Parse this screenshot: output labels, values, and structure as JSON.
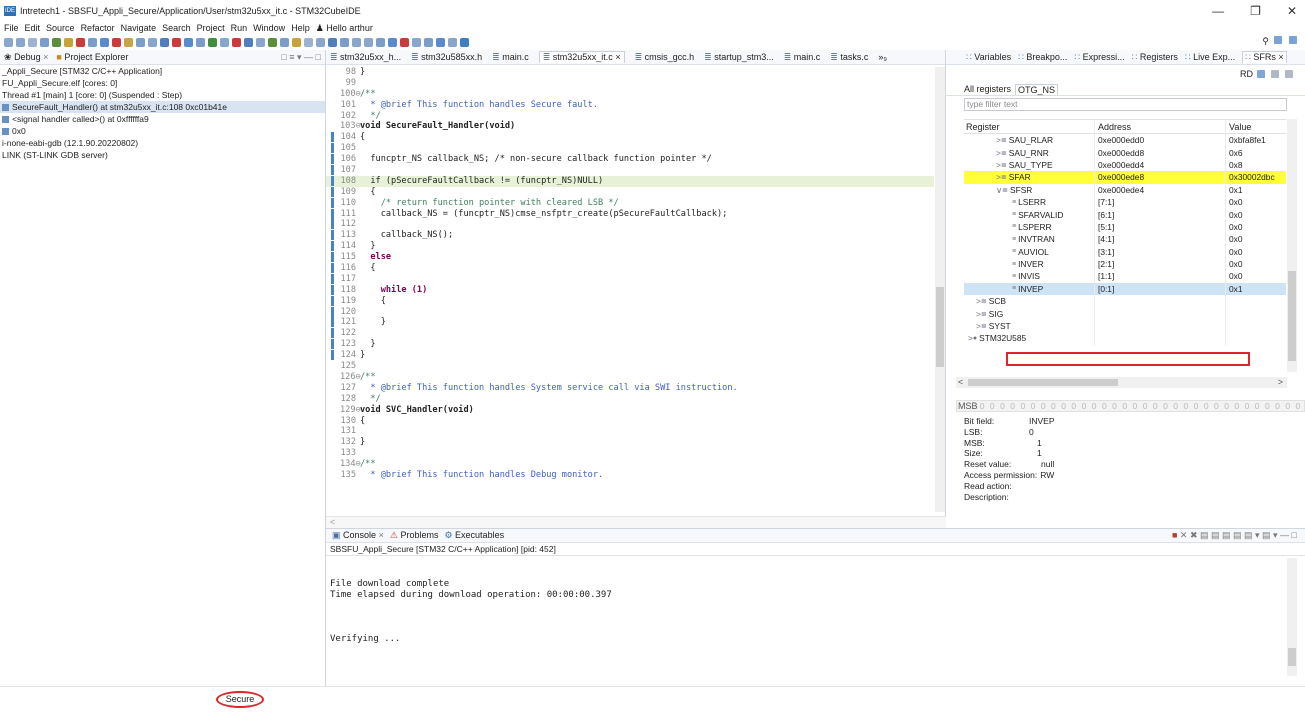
{
  "window": {
    "title": "Intretech1 - SBSFU_Appli_Secure/Application/User/stm32u5xx_it.c - STM32CubeIDE",
    "controls": [
      "—",
      "❐",
      "✕"
    ]
  },
  "menu": [
    "File",
    "Edit",
    "Source",
    "Refactor",
    "Navigate",
    "Search",
    "Project",
    "Run",
    "Window",
    "Help",
    "Hello arthur"
  ],
  "left_panel": {
    "tabs": [
      "Debug",
      "Project Explorer"
    ],
    "tree": [
      "_Appli_Secure [STM32 C/C++ Application]",
      "FU_Appli_Secure.elf [cores: 0]",
      "Thread #1 [main] 1 [core: 0] (Suspended : Step)",
      "SecureFault_Handler() at stm32u5xx_it.c:108 0xc01b41e",
      "<signal handler called>() at 0xffffffa9",
      "0x0",
      "i-none-eabi-gdb (12.1.90.20220802)",
      "LINK (ST-LINK GDB server)"
    ]
  },
  "editor": {
    "tabs": [
      "stm32u5xx_h...",
      "stm32u585xx.h",
      "main.c",
      "stm32u5xx_it.c",
      "cmsis_gcc.h",
      "startup_stm3...",
      "main.c",
      "tasks.c",
      "»₉"
    ],
    "lines": [
      {
        "n": "98",
        "t": "}",
        "c": ""
      },
      {
        "n": "99",
        "t": "",
        "c": ""
      },
      {
        "n": "100⊖",
        "t": "/**",
        "c": "cm"
      },
      {
        "n": "101",
        "t": "  * @brief This function handles Secure fault.",
        "c": "doc"
      },
      {
        "n": "102",
        "t": "  */",
        "c": "cm"
      },
      {
        "n": "103⊖",
        "t": "void SecureFault_Handler(void)",
        "c": "fn"
      },
      {
        "n": "104",
        "t": "{",
        "c": ""
      },
      {
        "n": "105",
        "t": "",
        "c": ""
      },
      {
        "n": "106",
        "t": "  funcptr_NS callback_NS; /* non-secure callback function pointer */",
        "c": ""
      },
      {
        "n": "107",
        "t": "",
        "c": ""
      },
      {
        "n": "108",
        "t": "  if (pSecureFaultCallback != (funcptr_NS)NULL)",
        "c": "hl"
      },
      {
        "n": "109",
        "t": "  {",
        "c": ""
      },
      {
        "n": "110",
        "t": "    /* return function pointer with cleared LSB */",
        "c": "cm"
      },
      {
        "n": "111",
        "t": "    callback_NS = (funcptr_NS)cmse_nsfptr_create(pSecureFaultCallback);",
        "c": ""
      },
      {
        "n": "112",
        "t": "",
        "c": ""
      },
      {
        "n": "113",
        "t": "    callback_NS();",
        "c": ""
      },
      {
        "n": "114",
        "t": "  }",
        "c": ""
      },
      {
        "n": "115",
        "t": "  else",
        "c": "kw"
      },
      {
        "n": "116",
        "t": "  {",
        "c": ""
      },
      {
        "n": "117",
        "t": "",
        "c": ""
      },
      {
        "n": "118",
        "t": "    while (1)",
        "c": "kw"
      },
      {
        "n": "119",
        "t": "    {",
        "c": ""
      },
      {
        "n": "120",
        "t": "",
        "c": ""
      },
      {
        "n": "121",
        "t": "    }",
        "c": ""
      },
      {
        "n": "122",
        "t": "",
        "c": ""
      },
      {
        "n": "123",
        "t": "  }",
        "c": ""
      },
      {
        "n": "124",
        "t": "}",
        "c": ""
      },
      {
        "n": "125",
        "t": "",
        "c": ""
      },
      {
        "n": "126⊖",
        "t": "/**",
        "c": "cm"
      },
      {
        "n": "127",
        "t": "  * @brief This function handles System service call via SWI instruction.",
        "c": "doc"
      },
      {
        "n": "128",
        "t": "  */",
        "c": "cm"
      },
      {
        "n": "129⊖",
        "t": "void SVC_Handler(void)",
        "c": "fn"
      },
      {
        "n": "130",
        "t": "{",
        "c": ""
      },
      {
        "n": "131",
        "t": "",
        "c": ""
      },
      {
        "n": "132",
        "t": "}",
        "c": ""
      },
      {
        "n": "133",
        "t": "",
        "c": ""
      },
      {
        "n": "134⊖",
        "t": "/**",
        "c": "cm"
      },
      {
        "n": "135",
        "t": "  * @brief This function handles Debug monitor.",
        "c": "doc"
      }
    ]
  },
  "right_panel": {
    "tabs": [
      "Variables",
      "Breakpo...",
      "Expressi...",
      "Registers",
      "Live Exp...",
      "SFRs"
    ],
    "toolbar_label": "RD",
    "subtabs": [
      "All registers",
      "OTG_NS"
    ],
    "filter_placeholder": "type filter text",
    "columns": [
      "Register",
      "Address",
      "Value"
    ],
    "rows": [
      {
        "indent": 1,
        "exp": ">",
        "name": "SAU_RLAR",
        "addr": "0xe000edd0",
        "val": "0xbfa8fe1",
        "style": ""
      },
      {
        "indent": 1,
        "exp": ">",
        "name": "SAU_RNR",
        "addr": "0xe000edd8",
        "val": "0x6",
        "style": ""
      },
      {
        "indent": 1,
        "exp": ">",
        "name": "SAU_TYPE",
        "addr": "0xe000edd4",
        "val": "0x8",
        "style": ""
      },
      {
        "indent": 1,
        "exp": ">",
        "name": "SFAR",
        "addr": "0xe000ede8",
        "val": "0x30002dbc",
        "style": "yellow"
      },
      {
        "indent": 1,
        "exp": "∨",
        "name": "SFSR",
        "addr": "0xe000ede4",
        "val": "0x1",
        "style": ""
      },
      {
        "indent": 2,
        "exp": "",
        "name": "LSERR",
        "addr": "[7:1]",
        "val": "0x0",
        "style": ""
      },
      {
        "indent": 2,
        "exp": "",
        "name": "SFARVALID",
        "addr": "[6:1]",
        "val": "0x0",
        "style": ""
      },
      {
        "indent": 2,
        "exp": "",
        "name": "LSPERR",
        "addr": "[5:1]",
        "val": "0x0",
        "style": ""
      },
      {
        "indent": 2,
        "exp": "",
        "name": "INVTRAN",
        "addr": "[4:1]",
        "val": "0x0",
        "style": ""
      },
      {
        "indent": 2,
        "exp": "",
        "name": "AUVIOL",
        "addr": "[3:1]",
        "val": "0x0",
        "style": ""
      },
      {
        "indent": 2,
        "exp": "",
        "name": "INVER",
        "addr": "[2:1]",
        "val": "0x0",
        "style": ""
      },
      {
        "indent": 2,
        "exp": "",
        "name": "INVIS",
        "addr": "[1:1]",
        "val": "0x0",
        "style": ""
      },
      {
        "indent": 2,
        "exp": "",
        "name": "INVEP",
        "addr": "[0:1]",
        "val": "0x1",
        "style": "selblue"
      },
      {
        "indent": 0,
        "exp": ">",
        "name": "SCB",
        "addr": "",
        "val": "",
        "style": ""
      },
      {
        "indent": 0,
        "exp": ">",
        "name": "SIG",
        "addr": "",
        "val": "",
        "style": ""
      },
      {
        "indent": 0,
        "exp": ">",
        "name": "SYST",
        "addr": "",
        "val": "",
        "style": ""
      },
      {
        "indent": -1,
        "exp": ">",
        "name": "STM32U585",
        "addr": "",
        "val": "",
        "style": ""
      }
    ],
    "msb_label": "MSB",
    "bits": "00000000000000000000000000000000",
    "bitinfo": [
      {
        "k": "Bit field:",
        "v": "INVEP"
      },
      {
        "k": "LSB:",
        "v": "0"
      },
      {
        "k": "MSB:",
        "v": "1"
      },
      {
        "k": "Size:",
        "v": "1"
      },
      {
        "k": "Reset value:",
        "v": "null"
      },
      {
        "k": "Access permission:",
        "v": "RW"
      },
      {
        "k": "Read action:",
        "v": ""
      },
      {
        "k": "Description:",
        "v": ""
      }
    ]
  },
  "console": {
    "tabs": [
      "Console",
      "Problems",
      "Executables"
    ],
    "title": "SBSFU_Appli_Secure [STM32 C/C++ Application]  [pid: 452]",
    "lines": [
      "File download complete",
      "Time elapsed during download operation: 00:00:00.397",
      "",
      "",
      "",
      "Verifying ..."
    ]
  },
  "status": {
    "secure": "Secure"
  }
}
